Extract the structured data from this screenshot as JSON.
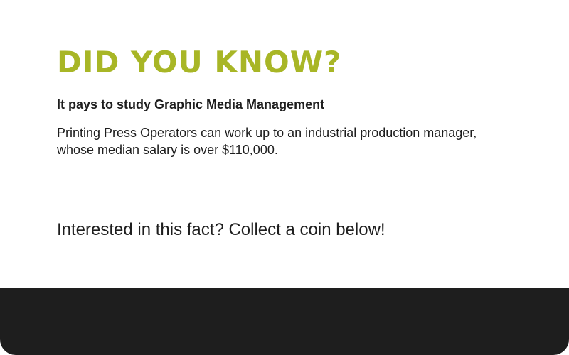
{
  "fact_card": {
    "heading": "Did you know?",
    "subheading": "It pays to study Graphic Media Management",
    "body": "Printing Press Operators can work up to an industrial production manager, whose median salary is over $110,000.",
    "call_to_action": "Interested in this fact? Collect a coin below!"
  },
  "colors": {
    "heading": "#a8b626",
    "text": "#1e1e1e",
    "background": "#ffffff",
    "footer_band": "#1e1e1e"
  }
}
